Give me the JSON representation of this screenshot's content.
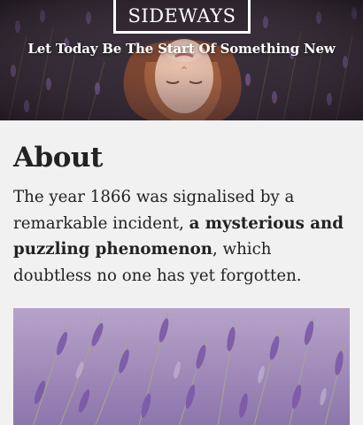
{
  "header": {
    "site_title": "SIDEWAYS",
    "tagline": "Let Today Be The Start Of Something New",
    "hero_image": "woman-lying-in-lavender-photo"
  },
  "page": {
    "title": "About",
    "intro_before": "The year 1866 was signalised by a remarkable incident, ",
    "intro_bold": "a mysterious and puzzling phenomenon",
    "intro_after": ", which doubtless no one has yet forgotten."
  },
  "media": {
    "content_image": "lavender-field-photo"
  },
  "colors": {
    "background": "#f1f1f1",
    "text": "#222222",
    "header_text": "#ffffff",
    "lavender": "#9d7fbf"
  }
}
